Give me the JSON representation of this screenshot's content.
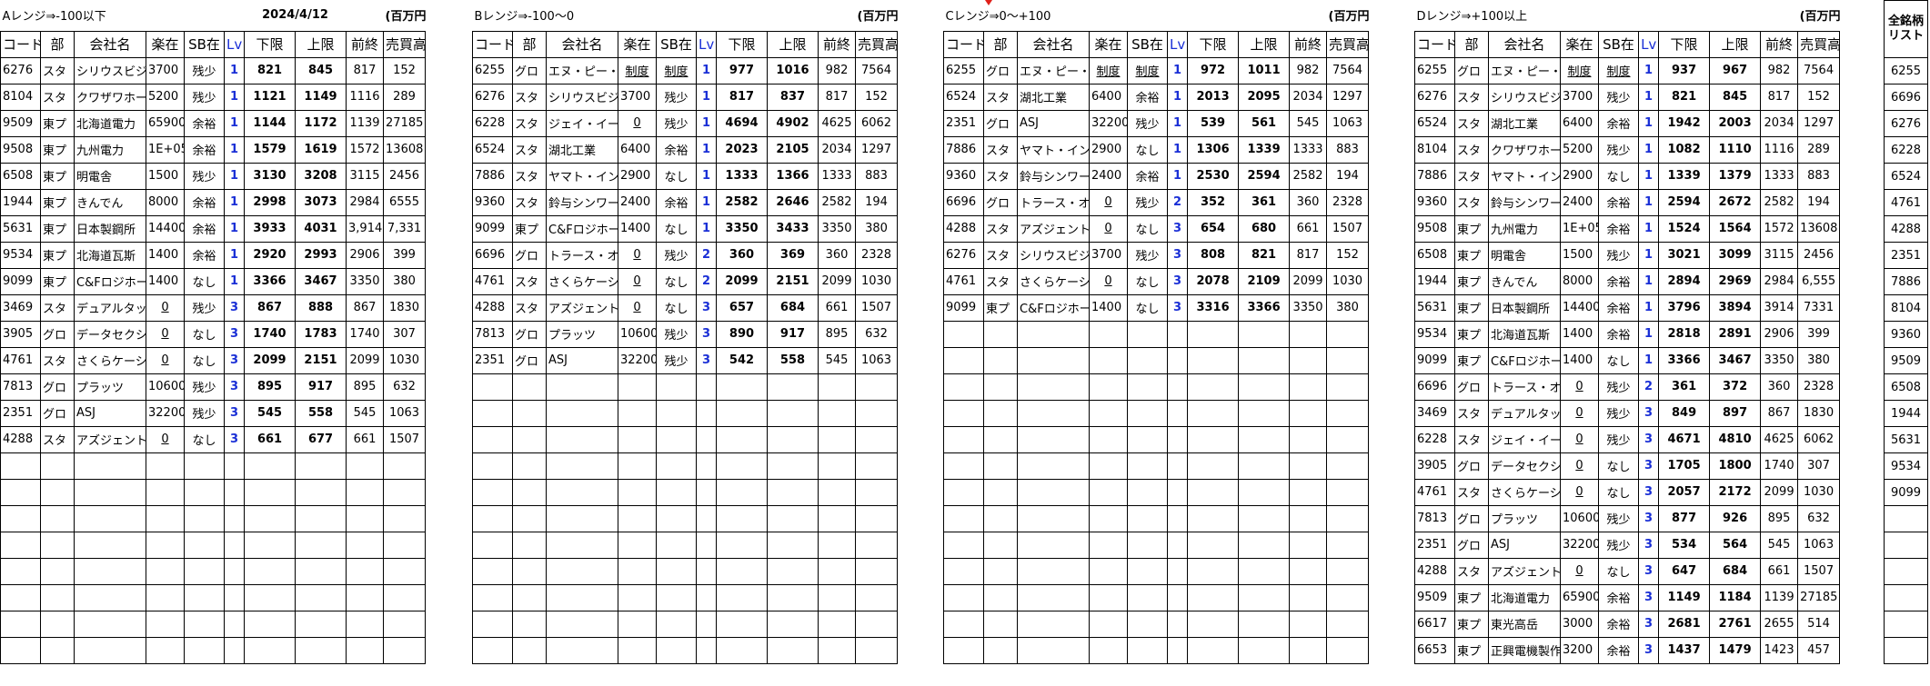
{
  "date": "2024/4/12",
  "unit": "(百万円)",
  "headers": {
    "code": "コード",
    "bu": "部",
    "name": "会社名",
    "stock": "楽在",
    "sb": "SB在",
    "lv": "Lv",
    "low": "下限",
    "high": "上限",
    "prev": "前終",
    "vol": "売買高"
  },
  "sections": [
    {
      "title": "Aレンジ⇒-100以下",
      "rows": [
        [
          "6276",
          "スタ",
          "シリウスビジョン",
          "3700",
          "残少",
          "1",
          "821",
          "845",
          "817",
          "152"
        ],
        [
          "8104",
          "スタ",
          "クワザワホールディングス",
          "5200",
          "残少",
          "1",
          "1121",
          "1149",
          "1116",
          "289"
        ],
        [
          "9509",
          "東プ",
          "北海道電力",
          "65900",
          "余裕",
          "1",
          "1144",
          "1172",
          "1139",
          "27185"
        ],
        [
          "9508",
          "東プ",
          "九州電力",
          "1E+05",
          "余裕",
          "1",
          "1579",
          "1619",
          "1572",
          "13608"
        ],
        [
          "6508",
          "東プ",
          "明電舎",
          "1500",
          "残少",
          "1",
          "3130",
          "3208",
          "3115",
          "2456"
        ],
        [
          "1944",
          "東プ",
          "きんでん",
          "8000",
          "余裕",
          "1",
          "2998",
          "3073",
          "2984",
          "6555"
        ],
        [
          "5631",
          "東プ",
          "日本製鋼所",
          "14400",
          "余裕",
          "1",
          "3933",
          "4031",
          "3,914",
          "7,331"
        ],
        [
          "9534",
          "東プ",
          "北海道瓦斯",
          "1400",
          "余裕",
          "1",
          "2920",
          "2993",
          "2906",
          "399"
        ],
        [
          "9099",
          "東プ",
          "C&Fロジホールディングス",
          "1400",
          "なし",
          "1",
          "3366",
          "3467",
          "3350",
          "380"
        ],
        [
          "3469",
          "スタ",
          "デュアルタップ",
          "0",
          "残少",
          "3",
          "867",
          "888",
          "867",
          "1830"
        ],
        [
          "3905",
          "グロ",
          "データセクション",
          "0",
          "なし",
          "3",
          "1740",
          "1783",
          "1740",
          "307"
        ],
        [
          "4761",
          "スタ",
          "さくらケーシーエス",
          "0",
          "なし",
          "3",
          "2099",
          "2151",
          "2099",
          "1030"
        ],
        [
          "7813",
          "グロ",
          "プラッツ",
          "10600",
          "残少",
          "3",
          "895",
          "917",
          "895",
          "632"
        ],
        [
          "2351",
          "グロ",
          "ASJ",
          "32200",
          "残少",
          "3",
          "545",
          "558",
          "545",
          "1063"
        ],
        [
          "4288",
          "スタ",
          "アズジェント",
          "0",
          "なし",
          "3",
          "661",
          "677",
          "661",
          "1507"
        ]
      ]
    },
    {
      "title": "Bレンジ⇒-100～0",
      "rows": [
        [
          "6255",
          "グロ",
          "エヌ・ピー・シー",
          "制度",
          "制度",
          "1",
          "977",
          "1016",
          "982",
          "7564"
        ],
        [
          "6276",
          "スタ",
          "シリウスビジョン",
          "3700",
          "残少",
          "1",
          "817",
          "837",
          "817",
          "152"
        ],
        [
          "6228",
          "スタ",
          "ジェイ・イー・ティ",
          "0",
          "残少",
          "1",
          "4694",
          "4902",
          "4625",
          "6062"
        ],
        [
          "6524",
          "スタ",
          "湖北工業",
          "6400",
          "余裕",
          "1",
          "2023",
          "2105",
          "2034",
          "1297"
        ],
        [
          "7886",
          "スタ",
          "ヤマト・インダストリー",
          "2900",
          "なし",
          "1",
          "1333",
          "1366",
          "1333",
          "883"
        ],
        [
          "9360",
          "スタ",
          "鈴与シンワート",
          "2400",
          "余裕",
          "1",
          "2582",
          "2646",
          "2582",
          "194"
        ],
        [
          "9099",
          "東プ",
          "C&Fロジホールディングス",
          "1400",
          "なし",
          "1",
          "3350",
          "3433",
          "3350",
          "380"
        ],
        [
          "6696",
          "グロ",
          "トラース・オン・プロダクト",
          "0",
          "残少",
          "2",
          "360",
          "369",
          "360",
          "2328"
        ],
        [
          "4761",
          "スタ",
          "さくらケーシーエス",
          "0",
          "なし",
          "2",
          "2099",
          "2151",
          "2099",
          "1030"
        ],
        [
          "4288",
          "スタ",
          "アズジェント",
          "0",
          "なし",
          "3",
          "657",
          "684",
          "661",
          "1507"
        ],
        [
          "7813",
          "グロ",
          "プラッツ",
          "10600",
          "残少",
          "3",
          "890",
          "917",
          "895",
          "632"
        ],
        [
          "2351",
          "グロ",
          "ASJ",
          "32200",
          "残少",
          "3",
          "542",
          "558",
          "545",
          "1063"
        ]
      ]
    },
    {
      "title": "Cレンジ⇒0～+100",
      "rows": [
        [
          "6255",
          "グロ",
          "エヌ・ピー・シー",
          "制度",
          "制度",
          "1",
          "972",
          "1011",
          "982",
          "7564"
        ],
        [
          "6524",
          "スタ",
          "湖北工業",
          "6400",
          "余裕",
          "1",
          "2013",
          "2095",
          "2034",
          "1297"
        ],
        [
          "2351",
          "グロ",
          "ASJ",
          "32200",
          "残少",
          "1",
          "539",
          "561",
          "545",
          "1063"
        ],
        [
          "7886",
          "スタ",
          "ヤマト・インダストリー",
          "2900",
          "なし",
          "1",
          "1306",
          "1339",
          "1333",
          "883"
        ],
        [
          "9360",
          "スタ",
          "鈴与シンワート",
          "2400",
          "余裕",
          "1",
          "2530",
          "2594",
          "2582",
          "194"
        ],
        [
          "6696",
          "グロ",
          "トラース・オン・プロダクト",
          "0",
          "残少",
          "2",
          "352",
          "361",
          "360",
          "2328"
        ],
        [
          "4288",
          "スタ",
          "アズジェント",
          "0",
          "なし",
          "3",
          "654",
          "680",
          "661",
          "1507"
        ],
        [
          "6276",
          "スタ",
          "シリウスビジョン",
          "3700",
          "残少",
          "3",
          "808",
          "821",
          "817",
          "152"
        ],
        [
          "4761",
          "スタ",
          "さくらケーシーエス",
          "0",
          "なし",
          "3",
          "2078",
          "2109",
          "2099",
          "1030"
        ],
        [
          "9099",
          "東プ",
          "C&Fロジホールディングス",
          "1400",
          "なし",
          "3",
          "3316",
          "3366",
          "3350",
          "380"
        ]
      ]
    },
    {
      "title": "Dレンジ⇒+100以上",
      "rows": [
        [
          "6255",
          "グロ",
          "エヌ・ピー・シー",
          "制度",
          "制度",
          "1",
          "937",
          "967",
          "982",
          "7564"
        ],
        [
          "6276",
          "スタ",
          "シリウスビジョン",
          "3700",
          "残少",
          "1",
          "821",
          "845",
          "817",
          "152"
        ],
        [
          "6524",
          "スタ",
          "湖北工業",
          "6400",
          "余裕",
          "1",
          "1942",
          "2003",
          "2034",
          "1297"
        ],
        [
          "8104",
          "スタ",
          "クワザワホールディングス",
          "5200",
          "残少",
          "1",
          "1082",
          "1110",
          "1116",
          "289"
        ],
        [
          "7886",
          "スタ",
          "ヤマト・インダストリー",
          "2900",
          "なし",
          "1",
          "1339",
          "1379",
          "1333",
          "883"
        ],
        [
          "9360",
          "スタ",
          "鈴与シンワート",
          "2400",
          "余裕",
          "1",
          "2594",
          "2672",
          "2582",
          "194"
        ],
        [
          "9508",
          "東プ",
          "九州電力",
          "1E+05",
          "余裕",
          "1",
          "1524",
          "1564",
          "1572",
          "13608"
        ],
        [
          "6508",
          "東プ",
          "明電舎",
          "1500",
          "残少",
          "1",
          "3021",
          "3099",
          "3115",
          "2456"
        ],
        [
          "1944",
          "東プ",
          "きんでん",
          "8000",
          "余裕",
          "1",
          "2894",
          "2969",
          "2984",
          "6,555"
        ],
        [
          "5631",
          "東プ",
          "日本製鋼所",
          "14400",
          "余裕",
          "1",
          "3796",
          "3894",
          "3914",
          "7331"
        ],
        [
          "9534",
          "東プ",
          "北海道瓦斯",
          "1400",
          "余裕",
          "1",
          "2818",
          "2891",
          "2906",
          "399"
        ],
        [
          "9099",
          "東プ",
          "C&Fロジホールディングス",
          "1400",
          "なし",
          "1",
          "3366",
          "3467",
          "3350",
          "380"
        ],
        [
          "6696",
          "グロ",
          "トラース・オン・プロダクト",
          "0",
          "残少",
          "2",
          "361",
          "372",
          "360",
          "2328"
        ],
        [
          "3469",
          "スタ",
          "デュアルタップ",
          "0",
          "残少",
          "3",
          "849",
          "897",
          "867",
          "1830"
        ],
        [
          "6228",
          "スタ",
          "ジェイ・イー・ティ",
          "0",
          "残少",
          "3",
          "4671",
          "4810",
          "4625",
          "6062"
        ],
        [
          "3905",
          "グロ",
          "データセクション",
          "0",
          "なし",
          "3",
          "1705",
          "1800",
          "1740",
          "307"
        ],
        [
          "4761",
          "スタ",
          "さくらケーシーエス",
          "0",
          "なし",
          "3",
          "2057",
          "2172",
          "2099",
          "1030"
        ],
        [
          "7813",
          "グロ",
          "プラッツ",
          "10600",
          "残少",
          "3",
          "877",
          "926",
          "895",
          "632"
        ],
        [
          "2351",
          "グロ",
          "ASJ",
          "32200",
          "残少",
          "3",
          "534",
          "564",
          "545",
          "1063"
        ],
        [
          "4288",
          "スタ",
          "アズジェント",
          "0",
          "なし",
          "3",
          "647",
          "684",
          "661",
          "1507"
        ],
        [
          "9509",
          "東プ",
          "北海道電力",
          "65900",
          "余裕",
          "3",
          "1149",
          "1184",
          "1139",
          "27185"
        ],
        [
          "6617",
          "東プ",
          "東光高岳",
          "3000",
          "余裕",
          "3",
          "2681",
          "2761",
          "2655",
          "514"
        ],
        [
          "6653",
          "東プ",
          "正興電機製作所",
          "3200",
          "余裕",
          "3",
          "1437",
          "1479",
          "1423",
          "457"
        ]
      ]
    }
  ],
  "all_list": {
    "header": "全銘柄リスト",
    "codes": [
      "6255",
      "6696",
      "6276",
      "6228",
      "6524",
      "4761",
      "4288",
      "2351",
      "7886",
      "8104",
      "9360",
      "9509",
      "6508",
      "1944",
      "5631",
      "9534",
      "9099"
    ]
  },
  "colors": {
    "lv": "#1a2fd6",
    "mark": "#e0201a"
  }
}
